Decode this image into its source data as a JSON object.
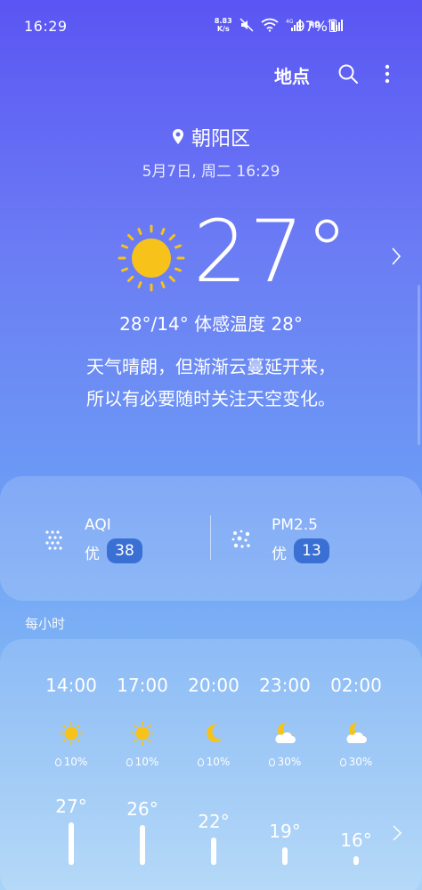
{
  "status_bar": {
    "time": "16:29",
    "net_speed_value": "8.83",
    "net_speed_unit": "K/s",
    "network_labels": [
      "4G",
      "HD",
      "4G"
    ],
    "battery": "97%"
  },
  "app_bar": {
    "locations_label": "地点",
    "search_icon": "search-icon",
    "more_icon": "more-vert-icon"
  },
  "current": {
    "location": "朝阳区",
    "datetime": "5月7日, 周二 16:29",
    "temperature": "27°",
    "range_feels": "28°/14° 体感温度 28°",
    "description_line1": "天气晴朗，但渐渐云蔓延开来，",
    "description_line2": "所以有必要随时关注天空变化。",
    "condition_icon": "sun-icon"
  },
  "air_quality": {
    "aqi": {
      "title": "AQI",
      "level": "优",
      "value": "38"
    },
    "pm25": {
      "title": "PM2.5",
      "level": "优",
      "value": "13"
    }
  },
  "hourly": {
    "label": "每小时",
    "items": [
      {
        "time": "14:00",
        "icon": "sun-icon",
        "precip": "10%",
        "temp": "27°",
        "temp_value": 27
      },
      {
        "time": "17:00",
        "icon": "sun-icon",
        "precip": "10%",
        "temp": "26°",
        "temp_value": 26
      },
      {
        "time": "20:00",
        "icon": "moon-icon",
        "precip": "10%",
        "temp": "22°",
        "temp_value": 22
      },
      {
        "time": "23:00",
        "icon": "moon-cloud-icon",
        "precip": "30%",
        "temp": "19°",
        "temp_value": 19
      },
      {
        "time": "02:00",
        "icon": "moon-cloud-icon",
        "precip": "30%",
        "temp": "16°",
        "temp_value": 16
      }
    ]
  },
  "colors": {
    "badge": "#3a6fd3",
    "sun": "#f7c31a",
    "moon": "#f7c31a"
  }
}
